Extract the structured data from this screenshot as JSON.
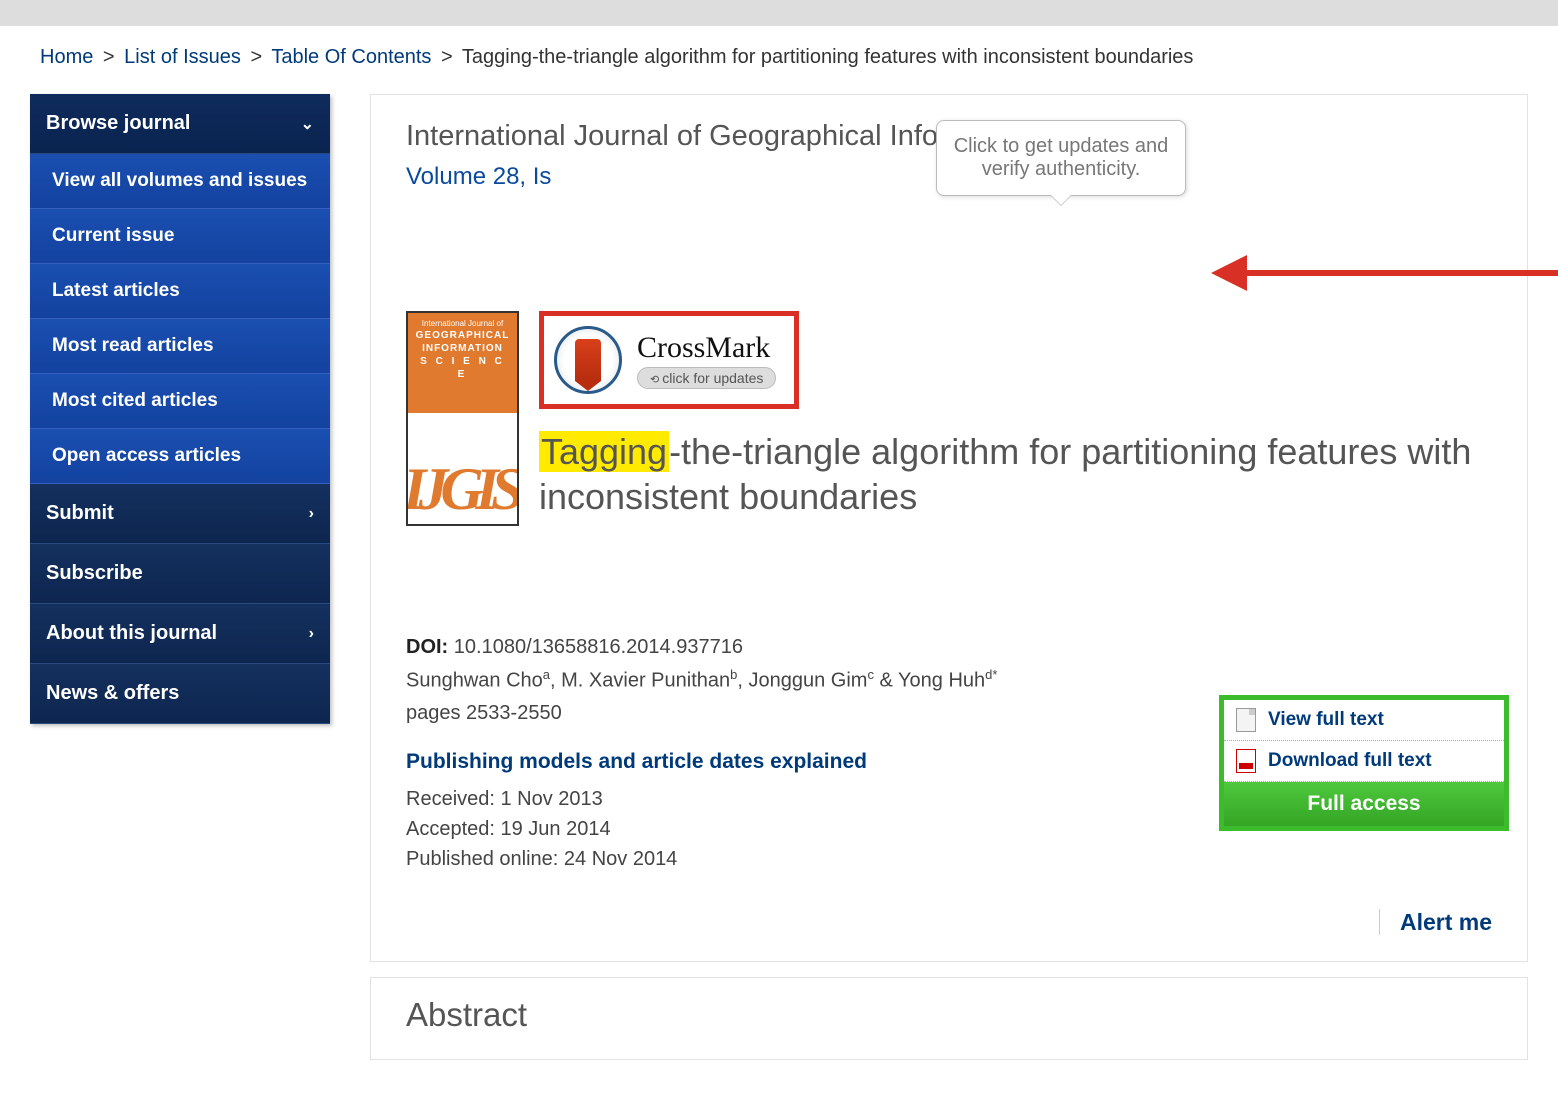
{
  "breadcrumb": {
    "home": "Home",
    "list": "List of Issues",
    "toc": "Table Of Contents",
    "current": "Tagging-the-triangle algorithm for partitioning features with inconsistent boundaries"
  },
  "sidebar": {
    "browse": "Browse journal",
    "items": [
      "View all volumes and issues",
      "Current issue",
      "Latest articles",
      "Most read articles",
      "Most cited articles",
      "Open access articles"
    ],
    "submit": "Submit",
    "subscribe": "Subscribe",
    "about": "About this journal",
    "news": "News & offers"
  },
  "journal": {
    "title": "International Journal of Geographical Information Science",
    "volume": "Volume 28, Is"
  },
  "tooltip": "Click to get updates and verify authenticity.",
  "crossmark": {
    "title": "CrossMark",
    "sub": "click for updates"
  },
  "cover": {
    "line1": "International Journal of",
    "line2": "GEOGRAPHICAL",
    "line3": "INFORMATION",
    "line4": "S C I E N C E",
    "logo": "IJGIS"
  },
  "article": {
    "highlight": "Tagging",
    "rest": "-the-triangle algorithm for partitioning features with inconsistent boundaries"
  },
  "doi": {
    "label": "DOI:",
    "value": "10.1080/13658816.2014.937716"
  },
  "authors": {
    "a1": "Sunghwan Cho",
    "s1": "a",
    "a2": "M. Xavier Punithan",
    "s2": "b",
    "a3": "Jonggun Gim",
    "s3": "c",
    "a4": "Yong Huh",
    "s4": "d*"
  },
  "pages": "pages 2533-2550",
  "pub_link": "Publishing models and article dates explained",
  "dates": {
    "received": "Received: 1 Nov 2013",
    "accepted": "Accepted: 19 Jun 2014",
    "published": "Published online: 24 Nov 2014"
  },
  "access": {
    "view": "View full text",
    "download": "Download full text",
    "full": "Full access"
  },
  "alert": "Alert me",
  "abstract": "Abstract"
}
